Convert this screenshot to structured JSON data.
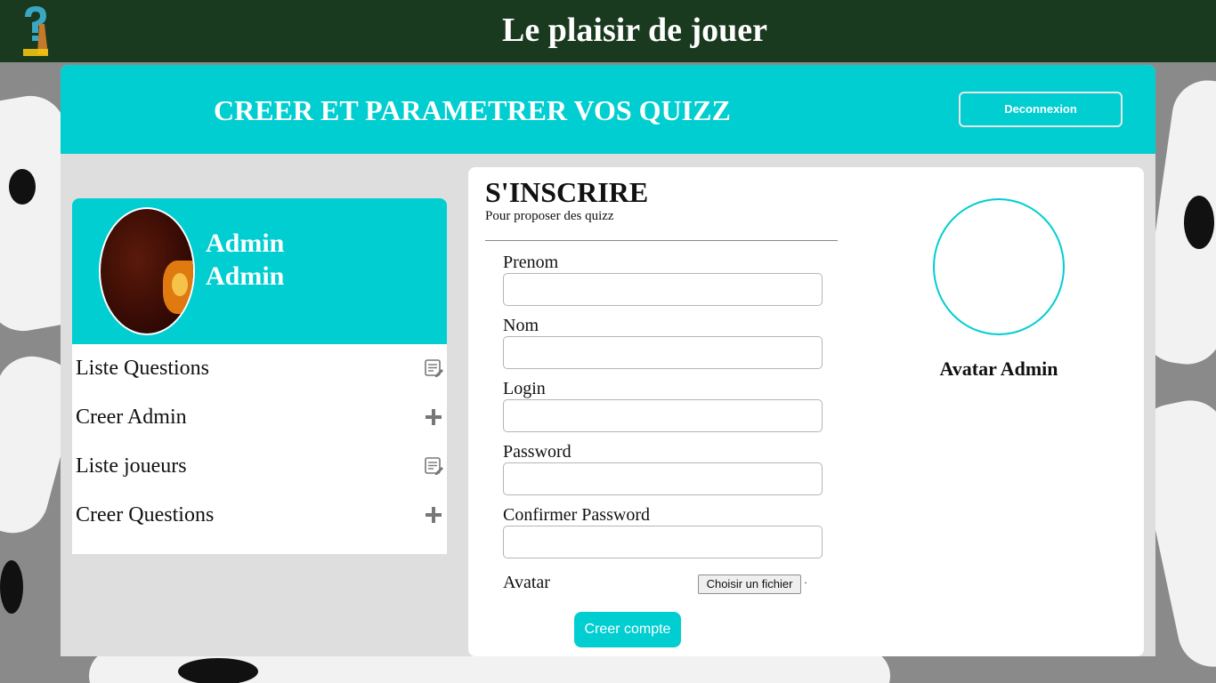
{
  "header": {
    "site_title": "Le plaisir de jouer",
    "logo_icon": "quizz-logo-icon"
  },
  "panel": {
    "title": "CREER ET PARAMETRER VOS QUIZZ",
    "logout_label": "Deconnexion"
  },
  "profile": {
    "first_name": "Admin",
    "last_name": "Admin"
  },
  "menu": {
    "items": [
      {
        "label": "Liste Questions",
        "icon": "list-edit-icon"
      },
      {
        "label": "Creer Admin",
        "icon": "plus-icon"
      },
      {
        "label": "Liste joueurs",
        "icon": "list-edit-icon"
      },
      {
        "label": "Creer Questions",
        "icon": "plus-icon"
      }
    ]
  },
  "form": {
    "title": "S'INSCRIRE",
    "subtitle": "Pour proposer des quizz",
    "fields": [
      {
        "label": "Prenom",
        "value": ""
      },
      {
        "label": "Nom",
        "value": ""
      },
      {
        "label": "Login",
        "value": ""
      },
      {
        "label": "Password",
        "value": ""
      },
      {
        "label": "Confirmer Password",
        "value": ""
      }
    ],
    "avatar_label": "Avatar",
    "file_button": "Choisir un fichier",
    "file_status": "·",
    "submit_label": "Creer compte"
  },
  "preview": {
    "caption": "Avatar Admin"
  },
  "colors": {
    "accent": "#00ced1",
    "header_bg": "#1a3a1f",
    "panel_bg": "#dedede"
  }
}
